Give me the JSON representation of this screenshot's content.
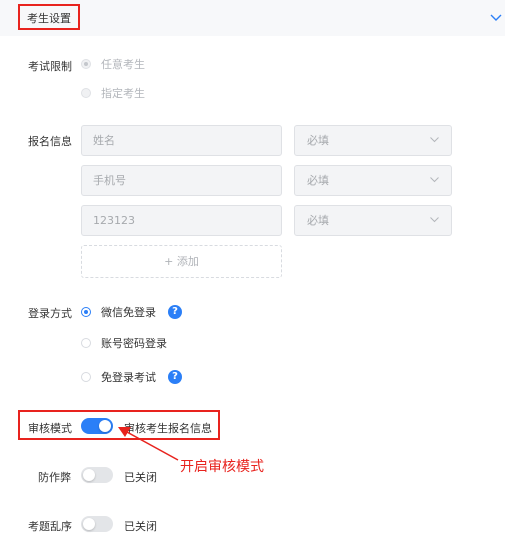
{
  "header": {
    "title": "考生设置",
    "collapse_icon": "chevron-down-icon"
  },
  "exam_limit": {
    "label": "考试限制",
    "options": [
      {
        "label": "任意考生",
        "checked": true,
        "disabled": true
      },
      {
        "label": "指定考生",
        "checked": false,
        "disabled": true
      }
    ]
  },
  "signup_info": {
    "label": "报名信息",
    "rows": [
      {
        "field": "姓名",
        "required": "必填"
      },
      {
        "field": "手机号",
        "required": "必填"
      },
      {
        "field": "123123",
        "required": "必填"
      }
    ],
    "add_label": "+ 添加"
  },
  "login": {
    "label": "登录方式",
    "options": [
      {
        "label": "微信免登录",
        "checked": true,
        "help": "?"
      },
      {
        "label": "账号密码登录",
        "checked": false
      },
      {
        "label": "免登录考试",
        "checked": false,
        "help": "?"
      }
    ]
  },
  "review": {
    "label": "审核模式",
    "on": true,
    "text": "审核考生报名信息"
  },
  "anti_cheat": {
    "label": "防作弊",
    "on": false,
    "text": "已关闭"
  },
  "shuffle": {
    "label": "考题乱序",
    "on": false,
    "text": "已关闭"
  },
  "annotation": {
    "text": "开启审核模式"
  },
  "colors": {
    "accent": "#2b7ff7",
    "highlight": "#e8231e"
  }
}
